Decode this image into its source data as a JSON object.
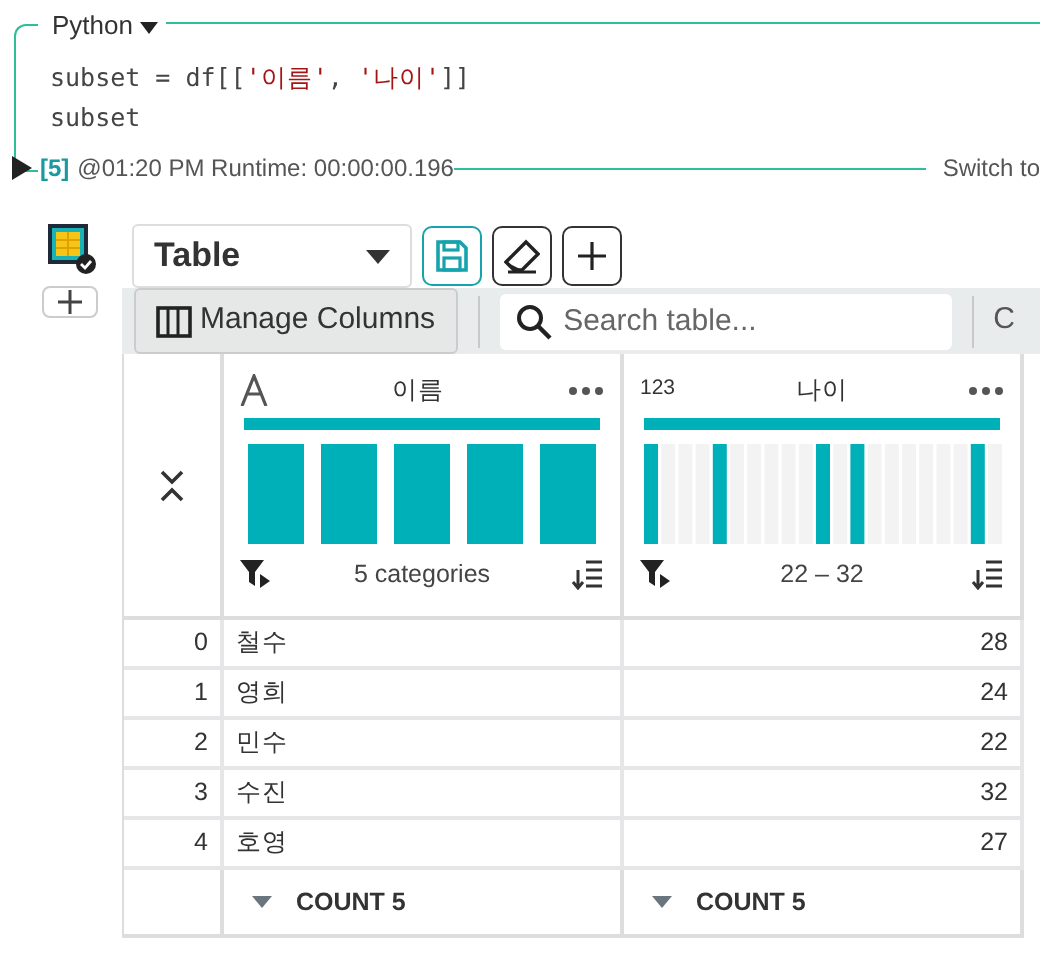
{
  "cell": {
    "language": "Python",
    "code": [
      [
        {
          "kind": "plain",
          "text": "subset = df[["
        },
        {
          "kind": "string",
          "text": "'이름'"
        },
        {
          "kind": "plain",
          "text": ", "
        },
        {
          "kind": "string",
          "text": "'나이'"
        },
        {
          "kind": "plain",
          "text": "]]"
        }
      ],
      [
        {
          "kind": "plain",
          "text": "subset"
        }
      ]
    ],
    "exec_count": "[5]",
    "run_info": "@01:20 PM Runtime: 00:00:00.196",
    "switch_label": "Switch to"
  },
  "output": {
    "view_select": "Table",
    "manage_columns": "Manage Columns",
    "search": {
      "placeholder": "Search table..."
    },
    "cut_label": "C",
    "columns": [
      {
        "kind": "text",
        "name": "이름",
        "summary": "5 categories",
        "footer": "COUNT 5"
      },
      {
        "type_label": "123",
        "kind": "number",
        "name": "나이",
        "summary": "22 – 32",
        "footer": "COUNT 5"
      }
    ],
    "rows": [
      {
        "index": "0",
        "cells": [
          "철수",
          "28"
        ]
      },
      {
        "index": "1",
        "cells": [
          "영희",
          "24"
        ]
      },
      {
        "index": "2",
        "cells": [
          "민수",
          "22"
        ]
      },
      {
        "index": "3",
        "cells": [
          "수진",
          "32"
        ]
      },
      {
        "index": "4",
        "cells": [
          "호영",
          "27"
        ]
      }
    ]
  }
}
